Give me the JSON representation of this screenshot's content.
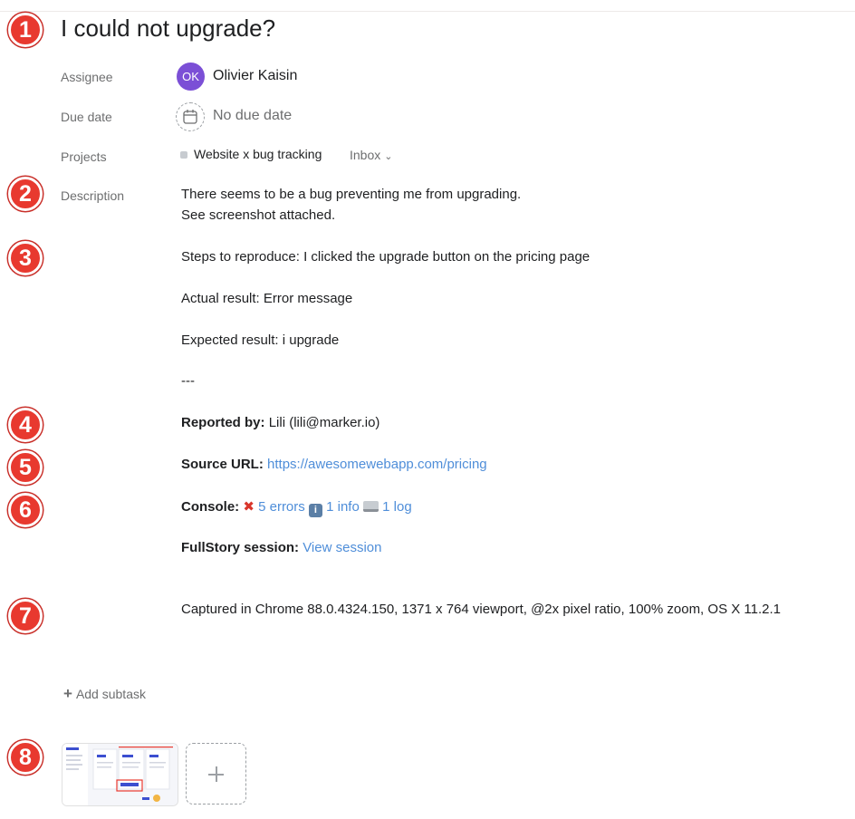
{
  "task": {
    "title": "I could not upgrade?",
    "fields": {
      "assignee_label": "Assignee",
      "assignee_initials": "OK",
      "assignee_name": "Olivier Kaisin",
      "due_label": "Due date",
      "due_value": "No due date",
      "projects_label": "Projects",
      "project_name": "Website x bug tracking",
      "project_section": "Inbox",
      "description_label": "Description"
    },
    "description": {
      "line1": "There seems to be a bug preventing me from upgrading.",
      "line2": "See screenshot attached.",
      "steps": "Steps to reproduce: I clicked the upgrade button on the pricing page",
      "actual": "Actual result: Error message",
      "expected": "Expected result: i upgrade",
      "separator": "---",
      "reported_label": "Reported by:",
      "reported_value": "Lili (lili@marker.io)",
      "source_label": "Source URL:",
      "source_url": "https://awesomewebapp.com/pricing",
      "console_label": "Console:",
      "console_errors": "5 errors",
      "console_info": "1 info",
      "console_log": "1 log",
      "fullstory_label": "FullStory session:",
      "fullstory_link": "View session",
      "captured": "Captured in Chrome 88.0.4324.150, 1371 x 764 viewport, @2x pixel ratio, 100% zoom, OS X 11.2.1"
    },
    "add_subtask": "Add subtask"
  },
  "markers": [
    "1",
    "2",
    "3",
    "4",
    "5",
    "6",
    "7",
    "8"
  ],
  "colors": {
    "marker": "#e8392f",
    "avatar": "#7b4fd6",
    "link": "#4f8ed9"
  },
  "icons": {
    "due_date": "calendar-icon",
    "section_dropdown": "chevron-down-icon",
    "add_subtask": "plus-icon",
    "add_attachment": "plus-icon"
  }
}
